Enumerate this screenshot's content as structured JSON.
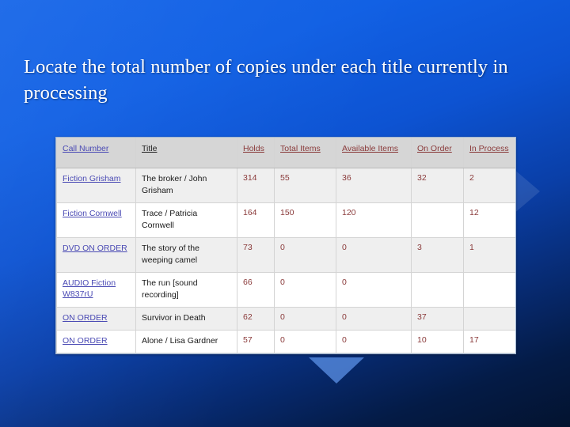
{
  "slide": {
    "heading": "Locate the total number of copies under each title currently in processing"
  },
  "table": {
    "columns": [
      {
        "label": "Call Number",
        "style": "blue"
      },
      {
        "label": "Title",
        "style": "dark"
      },
      {
        "label": "Holds",
        "style": "red"
      },
      {
        "label": "Total Items",
        "style": "red"
      },
      {
        "label": "Available Items",
        "style": "red"
      },
      {
        "label": "On Order",
        "style": "red"
      },
      {
        "label": "In Process",
        "style": "red"
      }
    ],
    "rows": [
      {
        "call_number": "Fiction Grisham",
        "title": "The broker / John Grisham",
        "holds": "314",
        "total_items": "55",
        "available_items": "36",
        "on_order": "32",
        "in_process": "2"
      },
      {
        "call_number": "Fiction Cornwell",
        "title": "Trace / Patricia Cornwell",
        "holds": "164",
        "total_items": "150",
        "available_items": "120",
        "on_order": "",
        "in_process": "12"
      },
      {
        "call_number": "DVD ON ORDER",
        "title": "The story of the weeping camel",
        "holds": "73",
        "total_items": "0",
        "available_items": "0",
        "on_order": "3",
        "in_process": "1"
      },
      {
        "call_number": "AUDIO Fiction W837rU",
        "title": "The run [sound recording]",
        "holds": "66",
        "total_items": "0",
        "available_items": "0",
        "on_order": "",
        "in_process": ""
      },
      {
        "call_number": "ON ORDER",
        "title": "Survivor in Death",
        "holds": "62",
        "total_items": "0",
        "available_items": "0",
        "on_order": "37",
        "in_process": ""
      },
      {
        "call_number": "ON ORDER",
        "title": "Alone / Lisa Gardner",
        "holds": "57",
        "total_items": "0",
        "available_items": "0",
        "on_order": "10",
        "in_process": "17"
      }
    ]
  },
  "colors": {
    "background_top": "#1565e8",
    "background_bottom": "#03132f",
    "heading_text": "#ffffff",
    "link_red": "#8a3a3a",
    "link_blue": "#4a4ab4",
    "header_bar": "#d6d6d6",
    "accent_triangle": "#6096eb"
  }
}
